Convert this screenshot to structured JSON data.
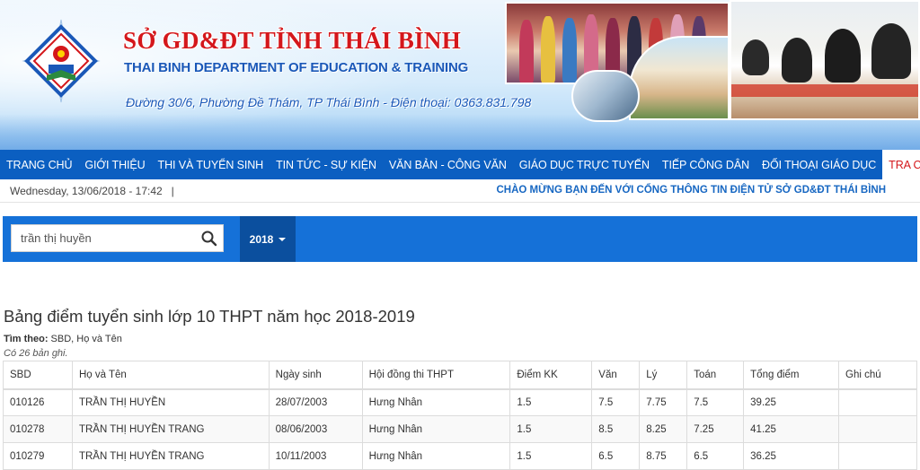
{
  "header": {
    "title": "SỞ GD&ĐT TỈNH THÁI BÌNH",
    "subtitle": "THAI BINH DEPARTMENT OF EDUCATION & TRAINING",
    "address": "Đường 30/6, Phường Đề Thám, TP Thái Bình - Điện thoại: 0363.831.798"
  },
  "nav": {
    "items": [
      {
        "label": "TRANG CHỦ"
      },
      {
        "label": "GIỚI THIỆU"
      },
      {
        "label": "THI VÀ TUYỂN SINH"
      },
      {
        "label": "TIN TỨC - SỰ KIỆN"
      },
      {
        "label": "VĂN BẢN - CÔNG VĂN"
      },
      {
        "label": "GIÁO DỤC TRỰC TUYẾN"
      },
      {
        "label": "TIẾP CÔNG DÂN"
      },
      {
        "label": "ĐỐI THOẠI GIÁO DỤC"
      },
      {
        "label": "TRA CỨU"
      }
    ],
    "active_index": 8
  },
  "info_bar": {
    "datetime": "Wednesday, 13/06/2018 - 17:42   |",
    "welcome": "CHÀO MỪNG BẠN ĐẾN VỚI CỔNG THÔNG TIN ĐIỆN TỬ SỞ GD&ĐT THÁI BÌNH"
  },
  "search": {
    "value": "trần thị huyền",
    "year": "2018"
  },
  "results": {
    "title": "Bảng điểm tuyển sinh lớp 10 THPT năm học 2018-2019",
    "search_by_label": "Tìm theo:",
    "search_by_value": " SBD, Họ và Tên",
    "count": "Có 26 bản ghi.",
    "columns": [
      "SBD",
      "Họ và Tên",
      "Ngày sinh",
      "Hội đồng thi THPT",
      "Điểm KK",
      "Văn",
      "Lý",
      "Toán",
      "Tổng điểm",
      "Ghi chú"
    ],
    "rows": [
      [
        "010126",
        "TRẦN THỊ HUYỀN",
        "28/07/2003",
        "Hưng Nhân",
        "1.5",
        "7.5",
        "7.75",
        "7.5",
        "39.25",
        ""
      ],
      [
        "010278",
        "TRẦN THỊ HUYỀN TRANG",
        "08/06/2003",
        "Hưng Nhân",
        "1.5",
        "8.5",
        "8.25",
        "7.25",
        "41.25",
        ""
      ],
      [
        "010279",
        "TRẦN THỊ HUYỀN TRANG",
        "10/11/2003",
        "Hưng Nhân",
        "1.5",
        "6.5",
        "8.75",
        "6.5",
        "36.25",
        ""
      ]
    ]
  },
  "colors": {
    "nav_bg": "#0b5fc1",
    "search_bg": "#1571d8",
    "title_red": "#d4171b",
    "accent_blue": "#1a58b8"
  },
  "icons": {
    "logo": "education-emblem-icon",
    "search": "search-icon",
    "dropdown": "caret-down-icon"
  }
}
